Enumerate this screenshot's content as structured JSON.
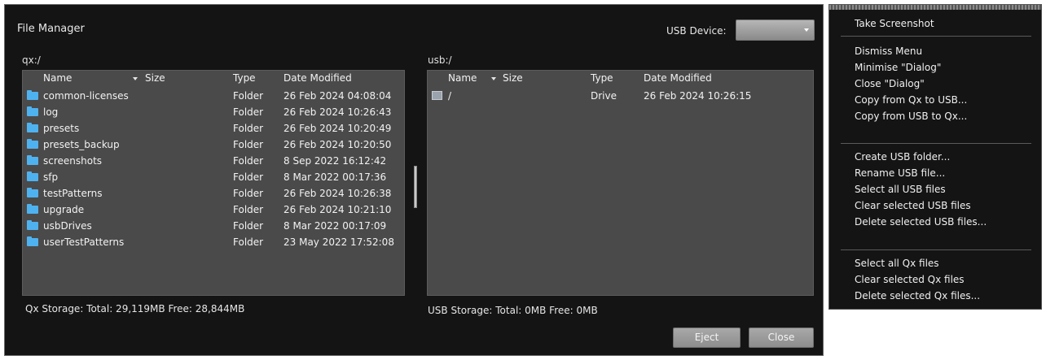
{
  "dialog": {
    "title": "File Manager",
    "usb_device_label": "USB Device:",
    "usb_device_value": ""
  },
  "left_pane": {
    "path": "qx:/",
    "headers": {
      "name": "Name",
      "size": "Size",
      "type": "Type",
      "date": "Date Modified"
    },
    "rows": [
      {
        "name": "common-licenses",
        "type": "Folder",
        "date": "26 Feb 2024 04:08:04"
      },
      {
        "name": "log",
        "type": "Folder",
        "date": "26 Feb 2024 10:26:43"
      },
      {
        "name": "presets",
        "type": "Folder",
        "date": "26 Feb 2024 10:20:49"
      },
      {
        "name": "presets_backup",
        "type": "Folder",
        "date": "26 Feb 2024 10:20:50"
      },
      {
        "name": "screenshots",
        "type": "Folder",
        "date": "8 Sep 2022 16:12:42"
      },
      {
        "name": "sfp",
        "type": "Folder",
        "date": "8 Mar 2022 00:17:36"
      },
      {
        "name": "testPatterns",
        "type": "Folder",
        "date": "26 Feb 2024 10:26:38"
      },
      {
        "name": "upgrade",
        "type": "Folder",
        "date": "26 Feb 2024 10:21:10"
      },
      {
        "name": "usbDrives",
        "type": "Folder",
        "date": "8 Mar 2022 00:17:09"
      },
      {
        "name": "userTestPatterns",
        "type": "Folder",
        "date": "23 May 2022 17:52:08"
      }
    ],
    "storage": "Qx Storage: Total: 29,119MB Free: 28,844MB"
  },
  "right_pane": {
    "path": "usb:/",
    "headers": {
      "name": "Name",
      "size": "Size",
      "type": "Type",
      "date": "Date Modified"
    },
    "rows": [
      {
        "name": "/",
        "type": "Drive",
        "date": "26 Feb 2024 10:26:15"
      }
    ],
    "storage": "USB Storage: Total: 0MB Free: 0MB"
  },
  "buttons": {
    "eject": "Eject",
    "close": "Close"
  },
  "context_menu": {
    "group1": [
      "Take Screenshot"
    ],
    "group2": [
      "Dismiss Menu",
      "Minimise \"Dialog\"",
      "Close \"Dialog\"",
      "Copy from Qx to USB...",
      "Copy from USB to Qx..."
    ],
    "group3": [
      "Create USB folder...",
      "Rename USB file...",
      "Select all USB files",
      "Clear selected USB files",
      "Delete selected USB files..."
    ],
    "group4": [
      "Select all Qx files",
      "Clear selected Qx files",
      "Delete selected Qx files..."
    ]
  },
  "colors": {
    "folder_icon": "#4fb2f0",
    "dialog_bg": "#141414",
    "pane_bg": "#4a4a4a"
  }
}
